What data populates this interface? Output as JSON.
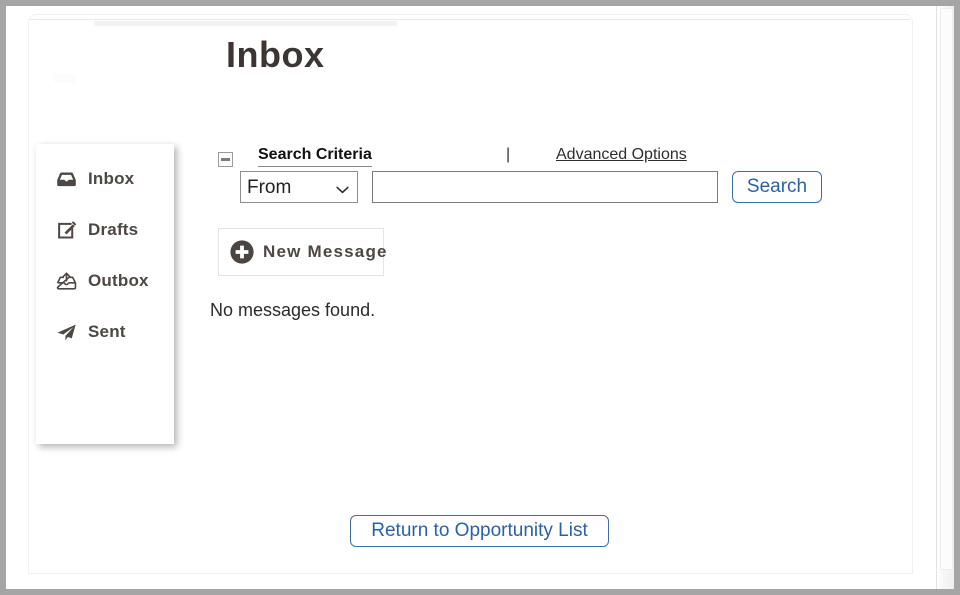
{
  "page": {
    "title": "Inbox"
  },
  "sidebar": {
    "items": [
      {
        "label": "Inbox",
        "icon": "inbox-tray-icon"
      },
      {
        "label": "Drafts",
        "icon": "pencil-square-icon"
      },
      {
        "label": "Outbox",
        "icon": "outbox-upload-icon"
      },
      {
        "label": "Sent",
        "icon": "paper-plane-icon"
      }
    ]
  },
  "search": {
    "collapse_icon": "minus-box-icon",
    "criteria_label": "Search Criteria",
    "divider": "|",
    "advanced_options_label": "Advanced Options",
    "field_selected": "From",
    "field_options": [
      "From"
    ],
    "select_arrow_icon": "chevron-down-icon",
    "query_value": "",
    "query_placeholder": "",
    "search_button_label": "Search"
  },
  "toolbar": {
    "new_message_label": "New Message",
    "new_message_icon": "plus-circle-icon"
  },
  "main": {
    "empty_message": "No messages found."
  },
  "footer": {
    "return_button_label": "Return to Opportunity List"
  },
  "colors": {
    "accent_blue": "#2a62a8",
    "text_dark": "#4d4745",
    "title_dark": "#3b3533",
    "frame_gray": "#a5a5a5"
  }
}
